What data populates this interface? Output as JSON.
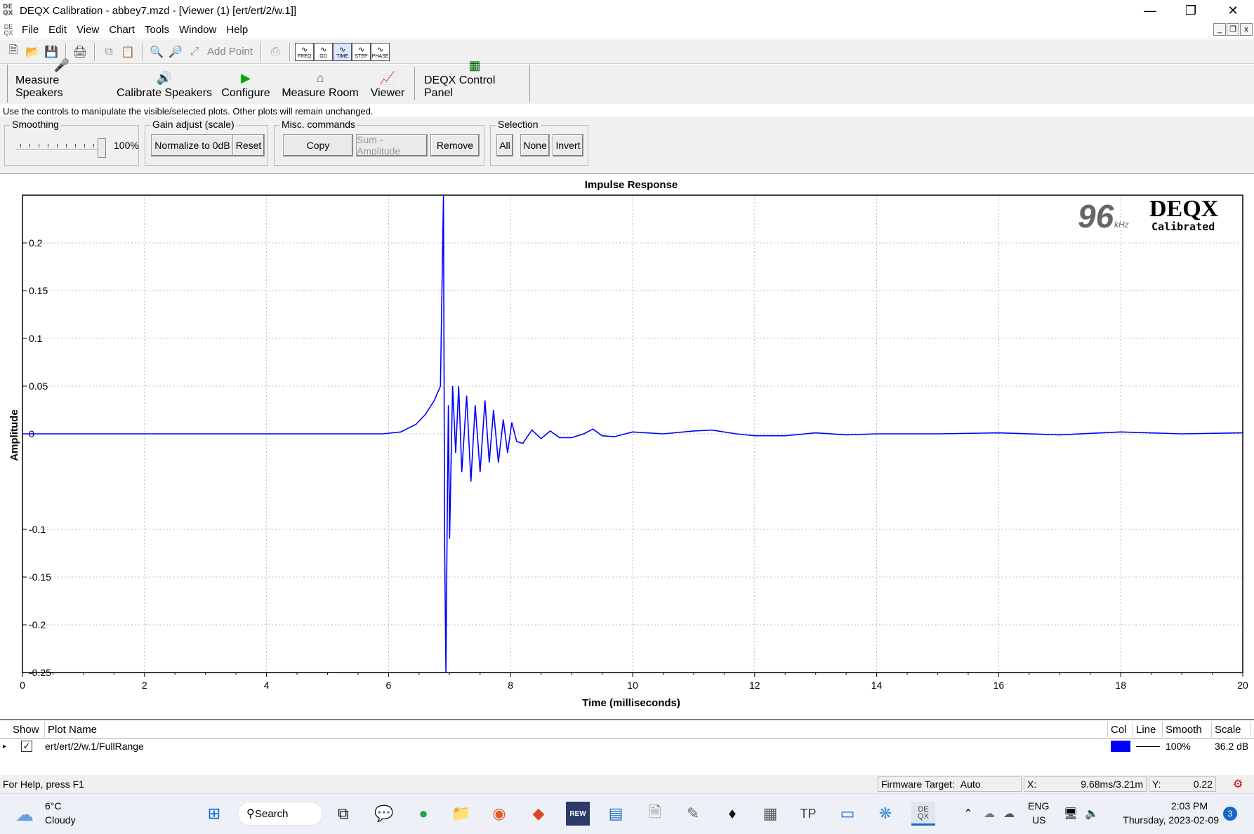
{
  "window": {
    "icon_text": "DE QX",
    "title": "DEQX Calibration - abbey7.mzd - [Viewer (1) [ert/ert/2/w.1]]",
    "minimize": "—",
    "maximize": "❐",
    "close": "✕"
  },
  "menu": {
    "items": [
      "File",
      "Edit",
      "View",
      "Chart",
      "Tools",
      "Window",
      "Help"
    ],
    "mdi": [
      "_",
      "❐",
      "x"
    ]
  },
  "toolbar": {
    "add_point": "Add Point",
    "mini_views": [
      "FREQ",
      "GD",
      "TIME",
      "STEP",
      "PHASE"
    ]
  },
  "main_buttons": [
    {
      "label": "Measure Speakers",
      "icon": "microphone-speaker-icon"
    },
    {
      "label": "Calibrate Speakers",
      "icon": "calibrate-speaker-icon"
    },
    {
      "label": "Configure",
      "icon": "green-play-icon"
    },
    {
      "label": "Measure Room",
      "icon": "room-icon"
    },
    {
      "label": "Viewer",
      "icon": "chart-viewer-icon"
    },
    {
      "label": "DEQX Control Panel",
      "icon": "control-panel-icon"
    }
  ],
  "hint": "Use the controls to manipulate the visible/selected plots.  Other plots will remain unchanged.",
  "controls": {
    "smoothing": {
      "label": "Smoothing",
      "value": "100%",
      "level": 1.0
    },
    "gain": {
      "label": "Gain adjust (scale)",
      "normalize": "Normalize to 0dB",
      "reset": "Reset"
    },
    "misc": {
      "label": "Misc. commands",
      "copy": "Copy",
      "sum": "Sum - Amplitude",
      "remove": "Remove"
    },
    "selection": {
      "label": "Selection",
      "all": "All",
      "none": "None",
      "invert": "Invert"
    }
  },
  "chart_data": {
    "type": "line",
    "title": "Impulse Response",
    "xlabel": "Time (milliseconds)",
    "ylabel": "Amplitude",
    "xlim": [
      0,
      20
    ],
    "ylim": [
      -0.25,
      0.25
    ],
    "x_ticks": [
      0,
      2,
      4,
      6,
      8,
      10,
      12,
      14,
      16,
      18,
      20
    ],
    "y_ticks": [
      0.2,
      0.15,
      0.1,
      0.05,
      0,
      -0.1,
      -0.15,
      -0.2,
      -0.25
    ],
    "y_tick_labels": [
      "0.2",
      "0.15",
      "0.1",
      "0.05",
      "0",
      "-0.1",
      "-0.15",
      "-0.2",
      "-0.25"
    ],
    "grid": true,
    "line_color": "#0000ff",
    "badge_rate": "96",
    "badge_unit": "kHz",
    "badge_brand": "DEQX",
    "badge_sub": "Calibrated",
    "series": [
      {
        "name": "ert/ert/2/w.1/FullRange",
        "x": [
          0,
          5.9,
          6.2,
          6.45,
          6.6,
          6.75,
          6.85,
          6.9,
          6.92,
          6.94,
          6.96,
          6.98,
          7.0,
          7.05,
          7.1,
          7.15,
          7.2,
          7.28,
          7.35,
          7.42,
          7.5,
          7.58,
          7.65,
          7.72,
          7.8,
          7.88,
          7.95,
          8.02,
          8.1,
          8.2,
          8.35,
          8.5,
          8.65,
          8.8,
          9.0,
          9.2,
          9.35,
          9.5,
          9.7,
          10.0,
          10.5,
          11.0,
          11.3,
          11.7,
          12.0,
          12.5,
          13.0,
          13.5,
          14.0,
          15.0,
          16.0,
          17.0,
          18.0,
          19.0,
          20.0
        ],
        "y": [
          0,
          0,
          0.002,
          0.01,
          0.02,
          0.035,
          0.05,
          0.25,
          -0.12,
          -0.25,
          -0.1,
          0.03,
          -0.11,
          0.05,
          -0.02,
          0.05,
          -0.04,
          0.04,
          -0.05,
          0.03,
          -0.04,
          0.035,
          -0.03,
          0.025,
          -0.03,
          0.015,
          -0.02,
          0.012,
          -0.008,
          -0.01,
          0.004,
          -0.005,
          0.003,
          -0.004,
          -0.004,
          0.0,
          0.005,
          -0.002,
          -0.003,
          0.002,
          0.0,
          0.003,
          0.004,
          0.0,
          -0.002,
          -0.002,
          0.001,
          -0.001,
          0.0,
          0.0,
          0.001,
          -0.001,
          0.002,
          0.0,
          0.001
        ]
      }
    ]
  },
  "plot_list": {
    "headers": {
      "show": "Show",
      "name": "Plot Name",
      "col": "Col",
      "line": "Line",
      "smooth": "Smooth",
      "scale": "Scale"
    },
    "rows": [
      {
        "checked": "✓",
        "name": "ert/ert/2/w.1/FullRange",
        "color": "#0000ff",
        "smooth": "100%",
        "scale": "36.2 dB"
      }
    ]
  },
  "status": {
    "help": "For Help, press F1",
    "firmware_label": "Firmware Target:",
    "firmware_value": "Auto",
    "x_label": "X:",
    "x_value": "9.68ms/3.21m",
    "y_label": "Y:",
    "y_value": "0.22"
  },
  "taskbar": {
    "weather_temp": "6°C",
    "weather_desc": "Cloudy",
    "search": "Search",
    "lang": "ENG",
    "region": "US",
    "time": "2:03 PM",
    "date": "Thursday, 2023-02-09",
    "notifications": "3",
    "rew_label": "REW",
    "tp_label": "TP",
    "deqx_label": "DE QX"
  }
}
